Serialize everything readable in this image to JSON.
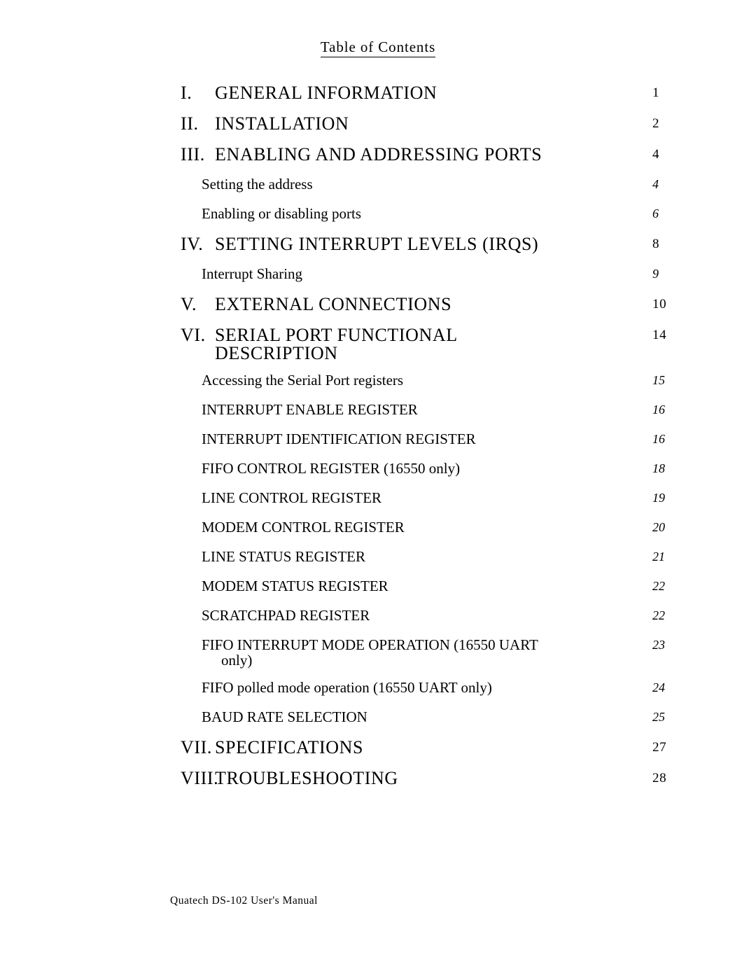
{
  "document": {
    "title": "Table of Contents",
    "footer": "Quatech DS-102 User's Manual"
  },
  "toc": {
    "entries": [
      {
        "number": "I.",
        "title": "GENERAL INFORMATION",
        "title_cont": "",
        "page": "1",
        "level": 1
      },
      {
        "number": "II.",
        "title": "INSTALLATION",
        "title_cont": "",
        "page": "2",
        "level": 1
      },
      {
        "number": "III.",
        "title": "ENABLING AND ADDRESSING PORTS",
        "title_cont": "",
        "page": "4",
        "level": 1
      },
      {
        "number": "",
        "title": "Setting the address",
        "title_cont": "",
        "page": "4",
        "level": 2
      },
      {
        "number": "",
        "title": "Enabling or disabling ports",
        "title_cont": "",
        "page": "6",
        "level": 2
      },
      {
        "number": "IV.",
        "title": "SETTING INTERRUPT LEVELS (IRQS)",
        "title_cont": "",
        "page": "8",
        "level": 1
      },
      {
        "number": "",
        "title": "Interrupt Sharing",
        "title_cont": "",
        "page": "9",
        "level": 2
      },
      {
        "number": "V.",
        "title": "EXTERNAL CONNECTIONS",
        "title_cont": "",
        "page": "10",
        "level": 1
      },
      {
        "number": "VI.",
        "title": "SERIAL PORT FUNCTIONAL",
        "title_cont": "DESCRIPTION",
        "page": "14",
        "level": 1
      },
      {
        "number": "",
        "title": "Accessing the Serial Port registers",
        "title_cont": "",
        "page": "15",
        "level": 2
      },
      {
        "number": "",
        "title": "INTERRUPT ENABLE REGISTER",
        "title_cont": "",
        "page": "16",
        "level": 2
      },
      {
        "number": "",
        "title": "INTERRUPT IDENTIFICATION REGISTER",
        "title_cont": "",
        "page": "16",
        "level": 2
      },
      {
        "number": "",
        "title": "FIFO CONTROL REGISTER (16550 only)",
        "title_cont": "",
        "page": "18",
        "level": 2
      },
      {
        "number": "",
        "title": "LINE CONTROL REGISTER",
        "title_cont": "",
        "page": "19",
        "level": 2
      },
      {
        "number": "",
        "title": "MODEM CONTROL REGISTER",
        "title_cont": "",
        "page": "20",
        "level": 2
      },
      {
        "number": "",
        "title": "LINE STATUS REGISTER",
        "title_cont": "",
        "page": "21",
        "level": 2
      },
      {
        "number": "",
        "title": "MODEM STATUS REGISTER",
        "title_cont": "",
        "page": "22",
        "level": 2
      },
      {
        "number": "",
        "title": "SCRATCHPAD REGISTER",
        "title_cont": "",
        "page": "22",
        "level": 2
      },
      {
        "number": "",
        "title": "FIFO INTERRUPT MODE OPERATION (16550  UART",
        "title_cont": "only)",
        "page": "23",
        "level": 2
      },
      {
        "number": "",
        "title": "FIFO polled mode operation (16550  UART only)",
        "title_cont": "",
        "page": "24",
        "level": 2
      },
      {
        "number": "",
        "title": "BAUD RATE SELECTION",
        "title_cont": "",
        "page": "25",
        "level": 2
      },
      {
        "number": "VII.",
        "title": "SPECIFICATIONS",
        "title_cont": "",
        "page": "27",
        "level": 1
      },
      {
        "number": "VIII.",
        "title": "TROUBLESHOOTING",
        "title_cont": "",
        "page": "28",
        "level": 1
      }
    ]
  }
}
